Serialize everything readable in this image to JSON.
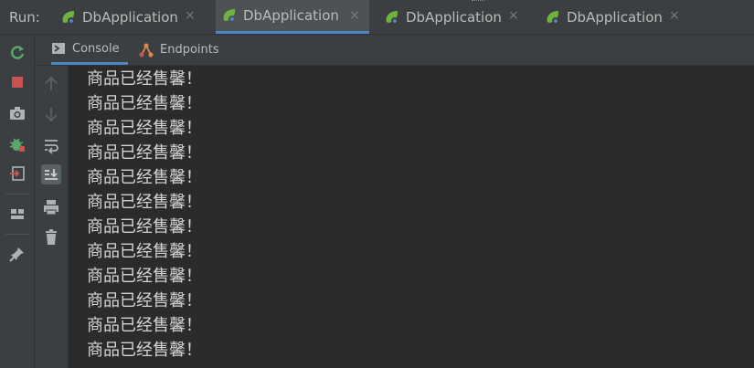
{
  "run_bar": {
    "label": "Run:",
    "tabs": [
      {
        "title": "DbApplication",
        "active": false
      },
      {
        "title": "DbApplication",
        "active": true
      },
      {
        "title": "DbApplication",
        "active": false
      },
      {
        "title": "DbApplication",
        "active": false
      }
    ],
    "close_glyph": "×"
  },
  "sub_tabs": [
    {
      "label": "Console",
      "icon": "console-icon",
      "active": true
    },
    {
      "label": "Endpoints",
      "icon": "endpoints-icon",
      "active": false
    }
  ],
  "left_toolbar": [
    "rerun-icon",
    "stop-icon",
    "screenshot-icon",
    "debug-icon",
    "restore-layout-icon",
    "layout-icon",
    "pin-icon"
  ],
  "console_toolbar": [
    "up-arrow-icon",
    "down-arrow-icon",
    "soft-wrap-icon",
    "scroll-to-end-icon",
    "print-icon",
    "trash-icon"
  ],
  "console": {
    "lines": [
      "商品已经售馨！",
      "商品已经售馨！",
      "商品已经售馨！",
      "商品已经售馨！",
      "商品已经售馨！",
      "商品已经售馨！",
      "商品已经售馨！",
      "商品已经售馨！",
      "商品已经售馨！",
      "商品已经售馨！",
      "商品已经售馨！",
      "商品已经售馨！"
    ]
  },
  "colors": {
    "accent": "#4a88c7",
    "spring_green": "#6db33f",
    "stop_red": "#c75450"
  }
}
